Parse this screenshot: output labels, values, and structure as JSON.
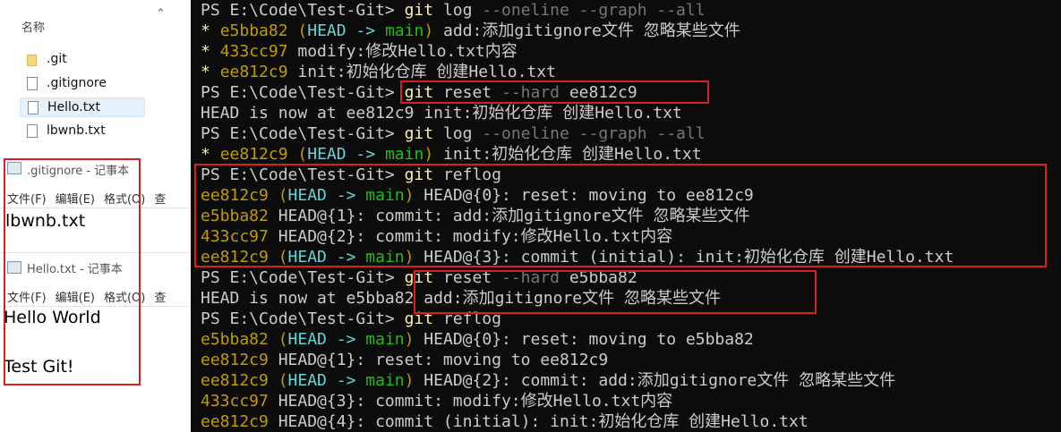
{
  "explorer": {
    "column_header": "名称",
    "files": [
      ".git",
      ".gitignore",
      "Hello.txt",
      "lbwnb.txt"
    ]
  },
  "notepad_gitignore": {
    "title": ".gitignore - 记事本",
    "menu": [
      "文件(F)",
      "编辑(E)",
      "格式(O)",
      "查"
    ],
    "content": "lbwnb.txt"
  },
  "notepad_hello": {
    "title": "Hello.txt - 记事本",
    "menu": [
      "文件(F)",
      "编辑(E)",
      "格式(O)",
      "查"
    ],
    "content_line1": "Hello  World",
    "content_line2": "Test Git!"
  },
  "terminal": {
    "prompt": "PS E:\\Code\\Test-Git>",
    "lines": [
      {
        "star": "",
        "hash": "",
        "head": "",
        "arrow": "",
        "branch": "",
        "rest": "",
        "cmd": "git",
        "arg1": " log",
        "arg2": " --oneline --graph --all",
        "arg3": "",
        "prompt": true
      },
      {
        "star": "* ",
        "hash": "e5bba82",
        "head": "HEAD",
        "arrow": " -> ",
        "branch": "main",
        "rest": " add:添加gitignore文件 忽略某些文件",
        "prompt": false
      },
      {
        "star": "* ",
        "hash": "433cc97",
        "head": "",
        "arrow": "",
        "branch": "",
        "rest": " modify:修改Hello.txt内容",
        "prompt": false
      },
      {
        "star": "* ",
        "hash": "ee812c9",
        "head": "",
        "arrow": "",
        "branch": "",
        "rest": " init:初始化仓库 创建Hello.txt",
        "prompt": false
      },
      {
        "cmd": "git",
        "arg1": " reset",
        "arg2": " --hard",
        "arg3": " ee812c9",
        "prompt": true
      },
      {
        "plain": "HEAD is now at ee812c9 init:初始化仓库 创建Hello.txt"
      },
      {
        "cmd": "git",
        "arg1": " log",
        "arg2": " --oneline --graph --all",
        "arg3": "",
        "prompt": true
      },
      {
        "star": "* ",
        "hash": "ee812c9",
        "head": "HEAD",
        "arrow": " -> ",
        "branch": "main",
        "rest": " init:初始化仓库 创建Hello.txt",
        "prompt": false
      },
      {
        "cmd": "git",
        "arg1": " reflog",
        "arg2": "",
        "arg3": "",
        "prompt": true
      },
      {
        "star": "",
        "hash": "ee812c9",
        "head": "HEAD",
        "arrow": " -> ",
        "branch": "main",
        "rest": " HEAD@{0}: reset: moving to ee812c9",
        "prompt": false
      },
      {
        "star": "",
        "hash": "e5bba82",
        "head": "",
        "arrow": "",
        "branch": "",
        "rest": " HEAD@{1}: commit: add:添加gitignore文件 忽略某些文件",
        "prompt": false
      },
      {
        "star": "",
        "hash": "433cc97",
        "head": "",
        "arrow": "",
        "branch": "",
        "rest": " HEAD@{2}: commit: modify:修改Hello.txt内容",
        "prompt": false
      },
      {
        "star": "",
        "hash": "ee812c9",
        "head": "HEAD",
        "arrow": " -> ",
        "branch": "main",
        "rest": " HEAD@{3}: commit (initial): init:初始化仓库 创建Hello.txt",
        "prompt": false
      },
      {
        "cmd": "git",
        "arg1": " reset",
        "arg2": " --hard",
        "arg3": " e5bba82",
        "prompt": true
      },
      {
        "plain": "HEAD is now at e5bba82 add:添加gitignore文件 忽略某些文件"
      },
      {
        "cmd": "git",
        "arg1": " reflog",
        "arg2": "",
        "arg3": "",
        "prompt": true
      },
      {
        "star": "",
        "hash": "e5bba82",
        "head": "HEAD",
        "arrow": " -> ",
        "branch": "main",
        "rest": " HEAD@{0}: reset: moving to e5bba82",
        "prompt": false
      },
      {
        "star": "",
        "hash": "ee812c9",
        "head": "",
        "arrow": "",
        "branch": "",
        "rest": " HEAD@{1}: reset: moving to ee812c9",
        "prompt": false
      },
      {
        "star": "",
        "hash": "ee812c9",
        "head": "HEAD",
        "arrow": " -> ",
        "branch": "main",
        "rest": " HEAD@{2}: commit: add:添加gitignore文件 忽略某些文件",
        "prompt": false
      },
      {
        "star": "",
        "hash": "433cc97",
        "head": "",
        "arrow": "",
        "branch": "",
        "rest": " HEAD@{3}: commit: modify:修改Hello.txt内容",
        "prompt": false
      },
      {
        "star": "",
        "hash": "ee812c9",
        "head": "",
        "arrow": "",
        "branch": "",
        "rest": " HEAD@{4}: commit (initial): init:初始化仓库 创建Hello.txt",
        "prompt": false
      }
    ]
  },
  "colors": {
    "terminal_bg": "#0c0c0c",
    "text": "#cccccc",
    "command": "#f9f1a5",
    "flag": "#767676",
    "hash": "#c19c00",
    "head": "#61d6d6",
    "branch": "#16c60c",
    "highlight_box": "#d92020"
  }
}
